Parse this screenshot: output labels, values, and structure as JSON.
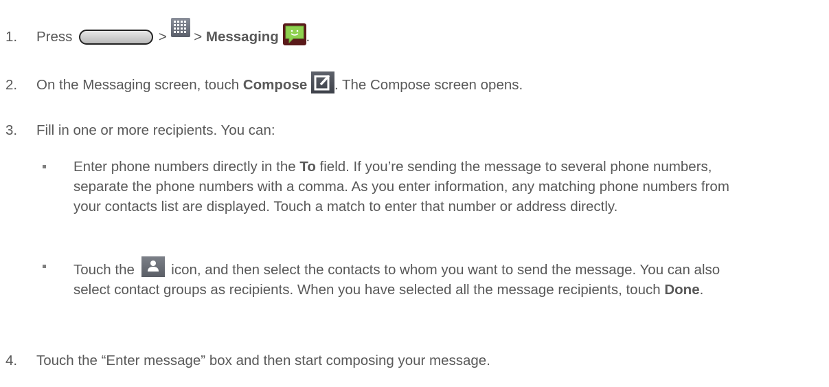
{
  "steps": [
    {
      "num": "1.",
      "parts": {
        "press": "Press",
        "gt1": ">",
        "gt2": ">",
        "messaging": "Messaging",
        "end": "."
      }
    },
    {
      "num": "2.",
      "parts": {
        "pre": "On the Messaging screen, touch ",
        "compose": "Compose",
        "post": ". The Compose screen opens."
      }
    },
    {
      "num": "3.",
      "text": "Fill in one or more recipients. You can:"
    },
    {
      "num": "4.",
      "text": "Touch the “Enter message” box and then start composing your message."
    }
  ],
  "bullets": [
    {
      "pre": "Enter phone numbers directly in the ",
      "bold": "To",
      "post": " field. If you’re sending the message to several phone numbers, separate the phone numbers with a comma. As you enter information, any matching phone numbers from your contacts list are displayed. Touch a match to enter that number or address directly."
    },
    {
      "pre": "Touch the ",
      "mid": " icon, and then select the contacts to whom you want to send the message. You can also select contact groups as recipients. When you have selected all the message recipients, touch ",
      "bold": "Done",
      "post": "."
    }
  ],
  "icons": {
    "home": "home-button-icon",
    "apps": "apps-grid-icon",
    "messaging": "messaging-app-icon",
    "compose": "compose-icon",
    "contacts": "contacts-icon"
  },
  "colors": {
    "text": "#595959",
    "messaging_icon_bg": "#5a1a1a",
    "messaging_bubble": "#8fd14f"
  }
}
